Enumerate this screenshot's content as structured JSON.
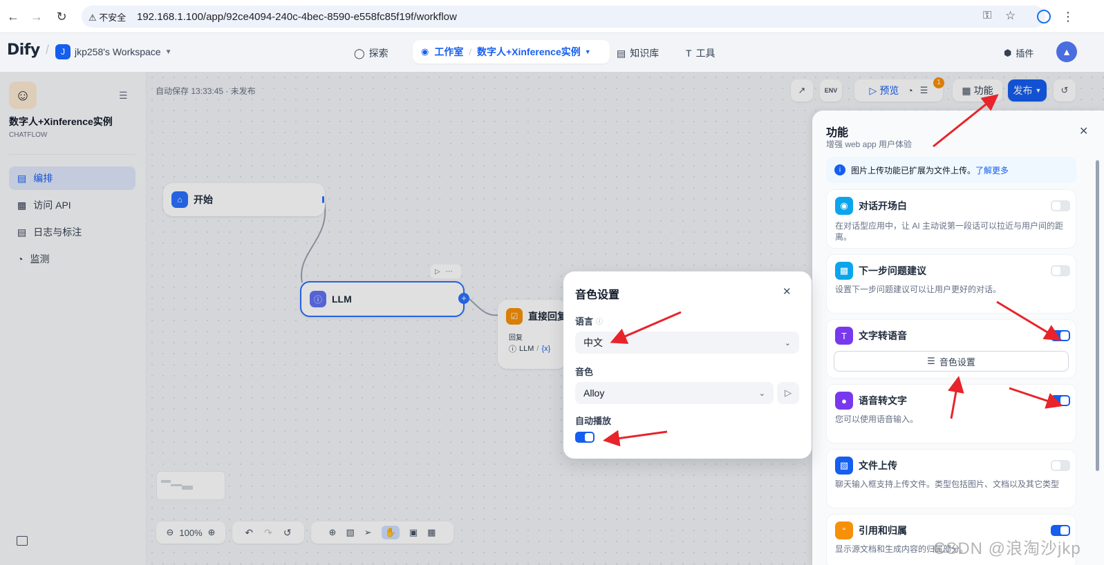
{
  "browser": {
    "not_secure": "不安全",
    "url": "192.168.1.100/app/92ce4094-240c-4bec-8590-e558fc85f19f/workflow"
  },
  "header": {
    "logo": "Dify",
    "workspace_initial": "J",
    "workspace": "jkp258's Workspace",
    "nav": {
      "explore": "探索",
      "studio": "工作室",
      "app_name": "数字人+Xinference实例",
      "knowledge": "知识库",
      "tools": "工具",
      "plugins": "插件"
    }
  },
  "sidebar": {
    "app_title": "数字人+Xinference实例",
    "app_type": "CHATFLOW",
    "items": [
      {
        "label": "编排",
        "icon": "layout-icon"
      },
      {
        "label": "访问 API",
        "icon": "terminal-icon"
      },
      {
        "label": "日志与标注",
        "icon": "file-icon"
      },
      {
        "label": "监测",
        "icon": "gauge-icon"
      }
    ]
  },
  "canvas": {
    "autosave": "自动保存 13:33:45 · 未发布",
    "nodes": {
      "start": "开始",
      "llm": "LLM",
      "answer": "直接回复",
      "answer_label": "回复",
      "answer_ref": "LLM",
      "answer_var": "{x}"
    },
    "toolbar": {
      "env": "ENV",
      "preview": "预览",
      "badge": "1",
      "features": "功能",
      "publish": "发布"
    },
    "zoom": "100%"
  },
  "feature_panel": {
    "title": "功能",
    "subtitle": "增强 web app 用户体验",
    "notice": "图片上传功能已扩展为文件上传。",
    "notice_link": "了解更多",
    "features": [
      {
        "title": "对话开场白",
        "desc": "在对话型应用中，让 AI 主动说第一段话可以拉近与用户间的距离。",
        "enabled": false,
        "color": "#0ba5ec"
      },
      {
        "title": "下一步问题建议",
        "desc": "设置下一步问题建议可以让用户更好的对话。",
        "enabled": false,
        "color": "#0ba5ec"
      },
      {
        "title": "文字转语音",
        "desc": "",
        "enabled": true,
        "color": "#7839ee",
        "button": "音色设置"
      },
      {
        "title": "语音转文字",
        "desc": "您可以使用语音输入。",
        "enabled": true,
        "color": "#7839ee"
      },
      {
        "title": "文件上传",
        "desc": "聊天输入框支持上传文件。类型包括图片、文档以及其它类型",
        "enabled": false,
        "color": "#155eef"
      },
      {
        "title": "引用和归属",
        "desc": "显示源文档和生成内容的归属部分。",
        "enabled": true,
        "color": "#f79009"
      }
    ]
  },
  "voice_dialog": {
    "title": "音色设置",
    "language_label": "语言",
    "language_value": "中文",
    "voice_label": "音色",
    "voice_value": "Alloy",
    "autoplay_label": "自动播放",
    "autoplay": true
  },
  "watermark": "CSDN @浪淘沙jkp",
  "colors": {
    "accent": "#155eef",
    "annotation": "#e8232a"
  }
}
